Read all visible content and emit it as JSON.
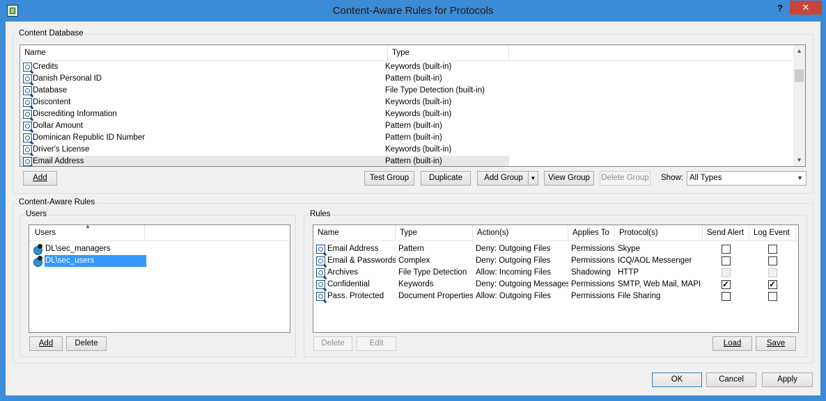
{
  "window": {
    "title": "Content-Aware Rules for Protocols",
    "help": "?",
    "close": "✕"
  },
  "content_db": {
    "group_label": "Content Database",
    "columns": [
      "Name",
      "Type"
    ],
    "rows": [
      {
        "name": "Credits",
        "type": "Keywords (built-in)"
      },
      {
        "name": "Danish Personal ID",
        "type": "Pattern (built-in)"
      },
      {
        "name": "Database",
        "type": "File Type Detection (built-in)"
      },
      {
        "name": "Discontent",
        "type": "Keywords (built-in)"
      },
      {
        "name": "Discrediting Information",
        "type": "Keywords (built-in)"
      },
      {
        "name": "Dollar Amount",
        "type": "Pattern (built-in)"
      },
      {
        "name": "Dominican Republic ID Number",
        "type": "Pattern (built-in)"
      },
      {
        "name": "Driver's License",
        "type": "Keywords (built-in)"
      },
      {
        "name": "Email Address",
        "type": "Pattern (built-in)"
      }
    ],
    "buttons": {
      "add": "Add",
      "test_group": "Test Group",
      "duplicate": "Duplicate",
      "add_group": "Add Group",
      "view_group": "View Group",
      "delete_group": "Delete Group"
    },
    "show_label": "Show:",
    "show_value": "All Types"
  },
  "car": {
    "group_label": "Content-Aware Rules",
    "users": {
      "group_label": "Users",
      "column": "Users",
      "items": [
        "DL\\sec_managers",
        "DL\\sec_users"
      ],
      "add": "Add",
      "delete": "Delete"
    },
    "rules": {
      "group_label": "Rules",
      "columns": [
        "Name",
        "Type",
        "Action(s)",
        "Applies To",
        "Protocol(s)",
        "Send Alert",
        "Log Event"
      ],
      "rows": [
        {
          "name": "Email Address",
          "type": "Pattern",
          "action": "Deny: Outgoing Files",
          "applies": "Permissions",
          "protocol": "Skype",
          "alert": "unchecked",
          "log": "unchecked"
        },
        {
          "name": "Email & Passwords",
          "type": "Complex",
          "action": "Deny: Outgoing Files",
          "applies": "Permissions",
          "protocol": "ICQ/AOL Messenger",
          "alert": "unchecked",
          "log": "unchecked"
        },
        {
          "name": "Archives",
          "type": "File Type Detection",
          "action": "Allow: Incoming Files",
          "applies": "Shadowing",
          "protocol": "HTTP",
          "alert": "disabled",
          "log": "disabled"
        },
        {
          "name": "Confidential",
          "type": "Keywords",
          "action": "Deny: Outgoing Messages",
          "applies": "Permissions",
          "protocol": "SMTP, Web Mail, MAPI",
          "alert": "checked",
          "log": "checked"
        },
        {
          "name": "Pass. Protected",
          "type": "Document Properties",
          "action": "Allow: Outgoing Files",
          "applies": "Permissions",
          "protocol": "File Sharing",
          "alert": "unchecked",
          "log": "unchecked"
        }
      ],
      "delete": "Delete",
      "edit": "Edit",
      "load": "Load",
      "save": "Save"
    }
  },
  "footer": {
    "ok": "OK",
    "cancel": "Cancel",
    "apply": "Apply"
  }
}
